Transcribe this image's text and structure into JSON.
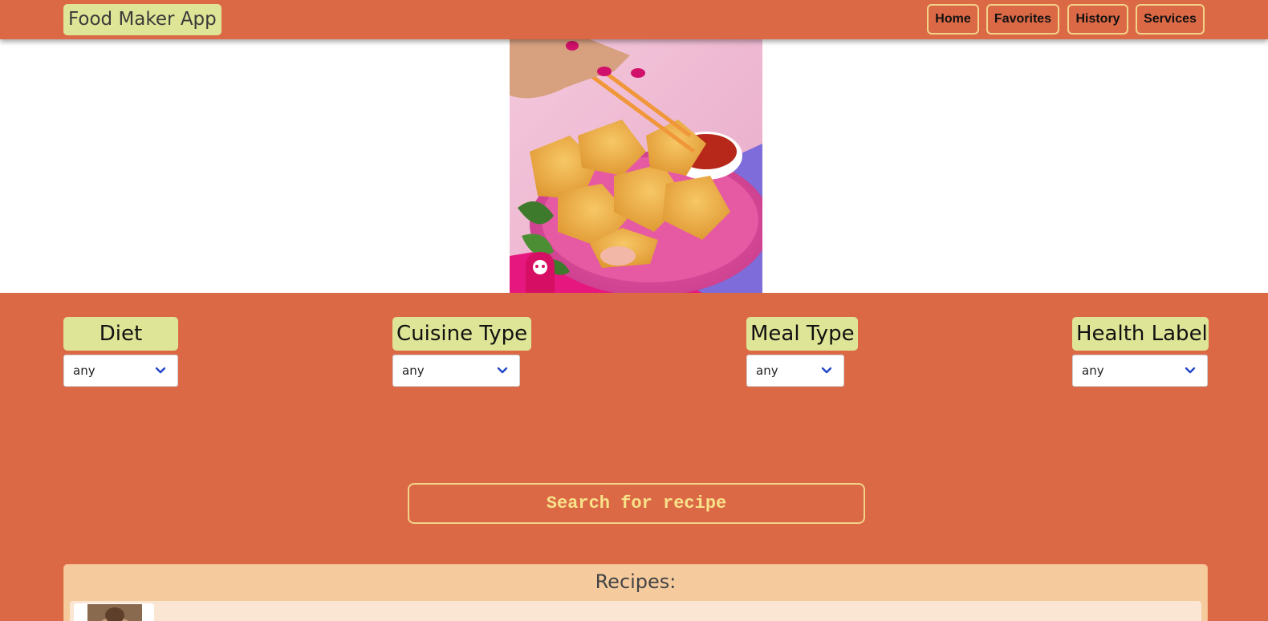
{
  "brand": {
    "title": "Food Maker App"
  },
  "nav": {
    "items": [
      {
        "label": "Home"
      },
      {
        "label": "Favorites"
      },
      {
        "label": "History"
      },
      {
        "label": "Services"
      }
    ]
  },
  "hero": {
    "image_icon": "fried-wontons-photo",
    "logo_icon": "panda-logo-icon"
  },
  "filters": [
    {
      "label": "Diet",
      "value": "any"
    },
    {
      "label": "Cuisine Type",
      "value": "any"
    },
    {
      "label": "Meal Type",
      "value": "any"
    },
    {
      "label": "Health Label",
      "value": "any"
    }
  ],
  "search": {
    "label": "Search for recipe"
  },
  "recipes": {
    "title": "Recipes:"
  },
  "colors": {
    "primary": "#DC6946",
    "label_bg": "#DFE596",
    "button_border": "#F2D38A",
    "search_text": "#F7E28A",
    "chevron": "#2346C8"
  }
}
